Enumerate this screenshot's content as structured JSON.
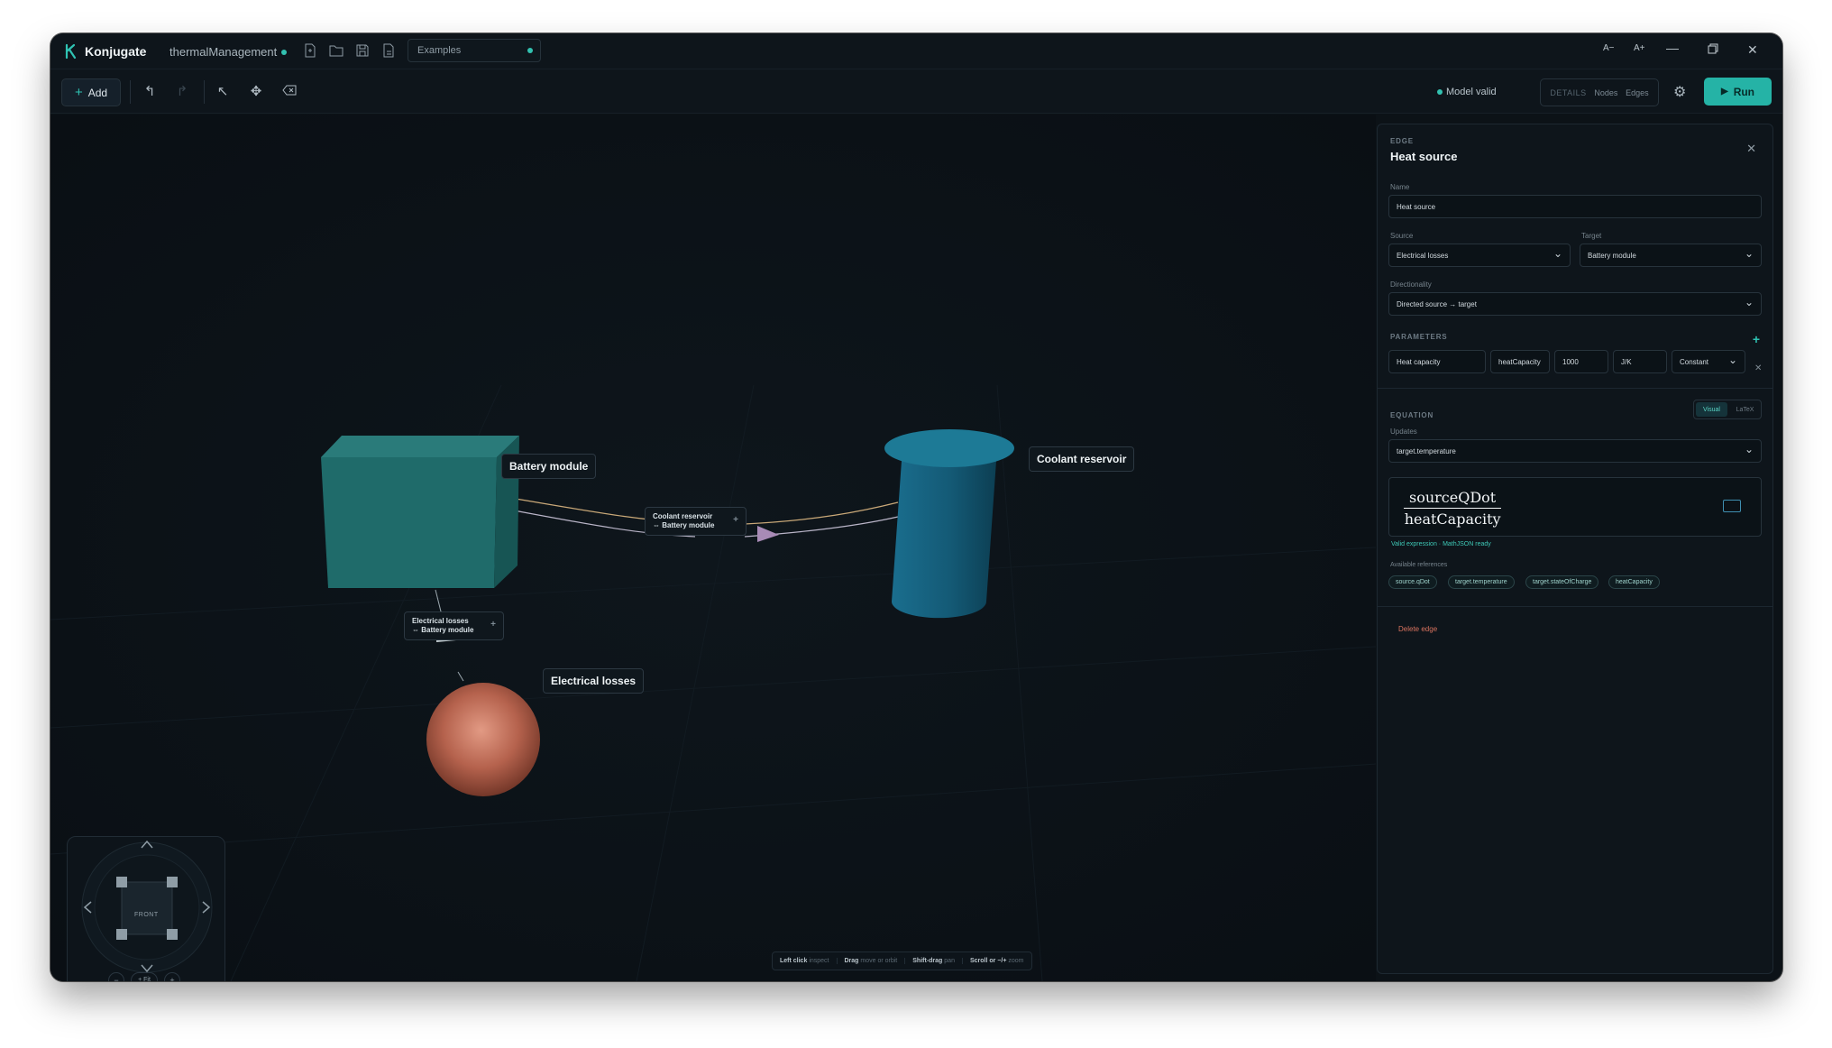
{
  "titlebar": {
    "app_name": "Konjugate",
    "project_name": "thermalManagement",
    "examples_label": "Examples",
    "font_decrease": "A−",
    "font_increase": "A+"
  },
  "toolbar": {
    "add_label": "Add",
    "model_status": "Model valid",
    "view_tabs": [
      "DETAILS",
      "Nodes",
      "Edges"
    ],
    "run_label": "Run"
  },
  "scene": {
    "nodes": [
      {
        "label": "Battery module",
        "shape": "box",
        "color": "#1f6b6a"
      },
      {
        "label": "Coolant reservoir",
        "shape": "cylinder",
        "color": "#16607e"
      },
      {
        "label": "Electrical losses",
        "shape": "sphere",
        "color": "#b5624d"
      }
    ],
    "edges": [
      {
        "line1": "Coolant reservoir",
        "line2": "⇔ Battery module"
      },
      {
        "line1": "Electrical losses",
        "line2": "⇔ Battery module"
      }
    ]
  },
  "nav_cube": {
    "face_label": "FRONT",
    "zoom_out": "−",
    "fit": "+ Fit",
    "zoom_in": "+"
  },
  "hints": [
    {
      "key": "Left click",
      "action": "inspect"
    },
    {
      "key": "Drag",
      "action": "move or orbit"
    },
    {
      "key": "Shift-drag",
      "action": "pan"
    },
    {
      "key": "Scroll or −/+",
      "action": "zoom"
    }
  ],
  "panel": {
    "kind": "EDGE",
    "title": "Heat source",
    "name_label": "Name",
    "name_value": "Heat source",
    "source_label": "Source",
    "source_value": "Electrical losses",
    "target_label": "Target",
    "target_value": "Battery module",
    "directionality_label": "Directionality",
    "directionality_value": "Directed source → target",
    "parameters_caption": "PARAMETERS",
    "parameter": {
      "label": "Heat capacity",
      "symbol": "heatCapacity",
      "value": "1000",
      "unit": "J/K",
      "kind": "Constant"
    },
    "equation_caption": "EQUATION",
    "modes": [
      "Visual",
      "LaTeX"
    ],
    "updates_label": "Updates",
    "updates_value": "target.temperature",
    "numerator": "sourceQDot",
    "denominator": "heatCapacity",
    "valid_note": "Valid expression · MathJSON ready",
    "refs_label": "Available references",
    "refs": [
      "source.qDot",
      "target.temperature",
      "target.stateOfCharge",
      "heatCapacity"
    ],
    "delete_label": "Delete edge"
  },
  "colors": {
    "accent": "#25b3a6",
    "background": "#0b1116",
    "danger": "#d9735f"
  }
}
